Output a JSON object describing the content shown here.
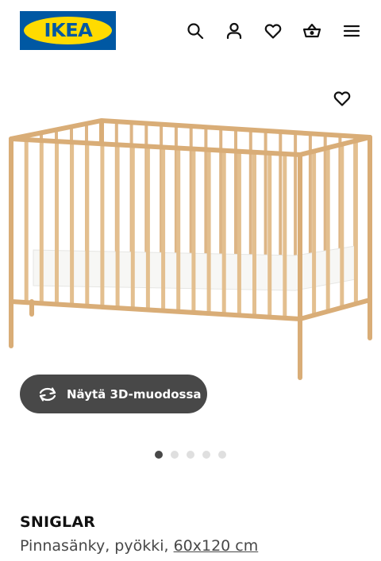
{
  "header": {
    "logo_text": "IKEA",
    "icons": [
      "search-icon",
      "user-icon",
      "heart-icon",
      "basket-icon",
      "menu-icon"
    ]
  },
  "media": {
    "view_3d_label": "Näytä 3D-muodossa",
    "dots_total": 5,
    "active_dot": 1
  },
  "product": {
    "name": "SNIGLAR",
    "description": "Pinnasänky, pyökki, ",
    "size": "60x120 cm"
  },
  "colors": {
    "ikea_blue": "#0058a3",
    "ikea_yellow": "#ffdb00",
    "button_dark": "#484848",
    "wood": "#e8c497"
  }
}
